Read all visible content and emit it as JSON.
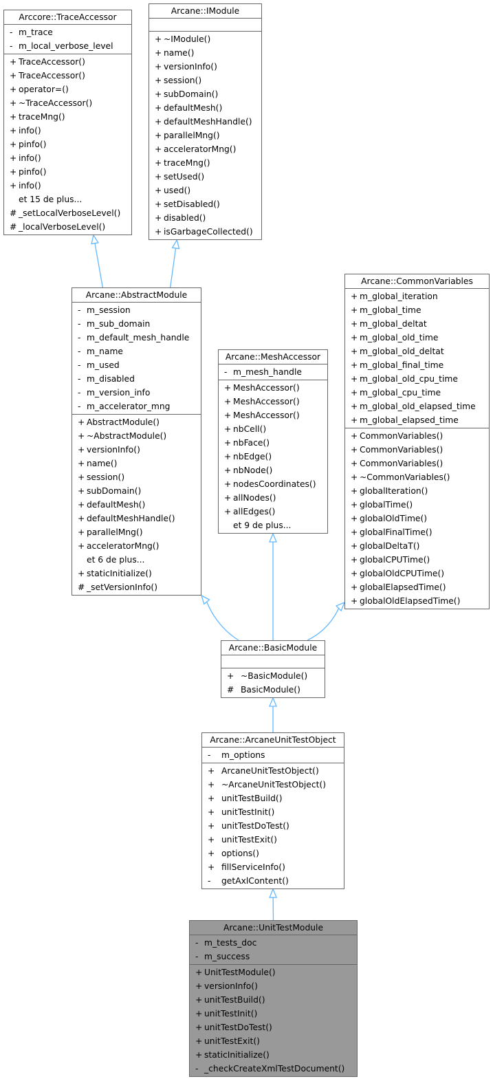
{
  "diagram": {
    "edge_color": "#63b8ff",
    "highlight_color": "#999999",
    "classes": {
      "trace_accessor": {
        "name": "Arccore::TraceAccessor",
        "attributes": [
          {
            "vis": "-",
            "name": "m_trace"
          },
          {
            "vis": "-",
            "name": "m_local_verbose_level"
          }
        ],
        "methods": [
          {
            "vis": "+",
            "name": "TraceAccessor()"
          },
          {
            "vis": "+",
            "name": "TraceAccessor()"
          },
          {
            "vis": "+",
            "name": "operator=()"
          },
          {
            "vis": "+",
            "name": "~TraceAccessor()"
          },
          {
            "vis": "+",
            "name": "traceMng()"
          },
          {
            "vis": "+",
            "name": "info()"
          },
          {
            "vis": "+",
            "name": "pinfo()"
          },
          {
            "vis": "+",
            "name": "info()"
          },
          {
            "vis": "+",
            "name": "pinfo()"
          },
          {
            "vis": "+",
            "name": "info()"
          },
          {
            "vis": "",
            "name": "et 15 de plus..."
          },
          {
            "vis": "#",
            "name": "_setLocalVerboseLevel()"
          },
          {
            "vis": "#",
            "name": "_localVerboseLevel()"
          }
        ]
      },
      "imodule": {
        "name": "Arcane::IModule",
        "attributes": [],
        "methods": [
          {
            "vis": "+",
            "name": "~IModule()"
          },
          {
            "vis": "+",
            "name": "name()"
          },
          {
            "vis": "+",
            "name": "versionInfo()"
          },
          {
            "vis": "+",
            "name": "session()"
          },
          {
            "vis": "+",
            "name": "subDomain()"
          },
          {
            "vis": "+",
            "name": "defaultMesh()"
          },
          {
            "vis": "+",
            "name": "defaultMeshHandle()"
          },
          {
            "vis": "+",
            "name": "parallelMng()"
          },
          {
            "vis": "+",
            "name": "acceleratorMng()"
          },
          {
            "vis": "+",
            "name": "traceMng()"
          },
          {
            "vis": "+",
            "name": "setUsed()"
          },
          {
            "vis": "+",
            "name": "used()"
          },
          {
            "vis": "+",
            "name": "setDisabled()"
          },
          {
            "vis": "+",
            "name": "disabled()"
          },
          {
            "vis": "+",
            "name": "isGarbageCollected()"
          }
        ]
      },
      "abstract_module": {
        "name": "Arcane::AbstractModule",
        "attributes": [
          {
            "vis": "-",
            "name": "m_session"
          },
          {
            "vis": "-",
            "name": "m_sub_domain"
          },
          {
            "vis": "-",
            "name": "m_default_mesh_handle"
          },
          {
            "vis": "-",
            "name": "m_name"
          },
          {
            "vis": "-",
            "name": "m_used"
          },
          {
            "vis": "-",
            "name": "m_disabled"
          },
          {
            "vis": "-",
            "name": "m_version_info"
          },
          {
            "vis": "-",
            "name": "m_accelerator_mng"
          }
        ],
        "methods": [
          {
            "vis": "+",
            "name": "AbstractModule()"
          },
          {
            "vis": "+",
            "name": "~AbstractModule()"
          },
          {
            "vis": "+",
            "name": "versionInfo()"
          },
          {
            "vis": "+",
            "name": "name()"
          },
          {
            "vis": "+",
            "name": "session()"
          },
          {
            "vis": "+",
            "name": "subDomain()"
          },
          {
            "vis": "+",
            "name": "defaultMesh()"
          },
          {
            "vis": "+",
            "name": "defaultMeshHandle()"
          },
          {
            "vis": "+",
            "name": "parallelMng()"
          },
          {
            "vis": "+",
            "name": "acceleratorMng()"
          },
          {
            "vis": "",
            "name": "et 6 de plus..."
          },
          {
            "vis": "+",
            "name": "staticInitialize()"
          },
          {
            "vis": "#",
            "name": "_setVersionInfo()"
          }
        ]
      },
      "mesh_accessor": {
        "name": "Arcane::MeshAccessor",
        "attributes": [
          {
            "vis": "-",
            "name": "m_mesh_handle"
          }
        ],
        "methods": [
          {
            "vis": "+",
            "name": "MeshAccessor()"
          },
          {
            "vis": "+",
            "name": "MeshAccessor()"
          },
          {
            "vis": "+",
            "name": "MeshAccessor()"
          },
          {
            "vis": "+",
            "name": "nbCell()"
          },
          {
            "vis": "+",
            "name": "nbFace()"
          },
          {
            "vis": "+",
            "name": "nbEdge()"
          },
          {
            "vis": "+",
            "name": "nbNode()"
          },
          {
            "vis": "+",
            "name": "nodesCoordinates()"
          },
          {
            "vis": "+",
            "name": "allNodes()"
          },
          {
            "vis": "+",
            "name": "allEdges()"
          },
          {
            "vis": "",
            "name": "et 9 de plus..."
          }
        ]
      },
      "common_variables": {
        "name": "Arcane::CommonVariables",
        "attributes": [
          {
            "vis": "+",
            "name": "m_global_iteration"
          },
          {
            "vis": "+",
            "name": "m_global_time"
          },
          {
            "vis": "+",
            "name": "m_global_deltat"
          },
          {
            "vis": "+",
            "name": "m_global_old_time"
          },
          {
            "vis": "+",
            "name": "m_global_old_deltat"
          },
          {
            "vis": "+",
            "name": "m_global_final_time"
          },
          {
            "vis": "+",
            "name": "m_global_old_cpu_time"
          },
          {
            "vis": "+",
            "name": "m_global_cpu_time"
          },
          {
            "vis": "+",
            "name": "m_global_old_elapsed_time"
          },
          {
            "vis": "+",
            "name": "m_global_elapsed_time"
          }
        ],
        "methods": [
          {
            "vis": "+",
            "name": "CommonVariables()"
          },
          {
            "vis": "+",
            "name": "CommonVariables()"
          },
          {
            "vis": "+",
            "name": "CommonVariables()"
          },
          {
            "vis": "+",
            "name": "~CommonVariables()"
          },
          {
            "vis": "+",
            "name": "globalIteration()"
          },
          {
            "vis": "+",
            "name": "globalTime()"
          },
          {
            "vis": "+",
            "name": "globalOldTime()"
          },
          {
            "vis": "+",
            "name": "globalFinalTime()"
          },
          {
            "vis": "+",
            "name": "globalDeltaT()"
          },
          {
            "vis": "+",
            "name": "globalCPUTime()"
          },
          {
            "vis": "+",
            "name": "globalOldCPUTime()"
          },
          {
            "vis": "+",
            "name": "globalElapsedTime()"
          },
          {
            "vis": "+",
            "name": "globalOldElapsedTime()"
          }
        ]
      },
      "basic_module": {
        "name": "Arcane::BasicModule",
        "attributes": [],
        "methods": [
          {
            "vis": "+",
            "name": "~BasicModule()"
          },
          {
            "vis": "#",
            "name": "BasicModule()"
          }
        ]
      },
      "arcane_unit_test_object": {
        "name": "Arcane::ArcaneUnitTestObject",
        "attributes": [
          {
            "vis": "-",
            "name": "m_options"
          }
        ],
        "methods": [
          {
            "vis": "+",
            "name": "ArcaneUnitTestObject()"
          },
          {
            "vis": "+",
            "name": "~ArcaneUnitTestObject()"
          },
          {
            "vis": "+",
            "name": "unitTestBuild()"
          },
          {
            "vis": "+",
            "name": "unitTestInit()"
          },
          {
            "vis": "+",
            "name": "unitTestDoTest()"
          },
          {
            "vis": "+",
            "name": "unitTestExit()"
          },
          {
            "vis": "+",
            "name": "options()"
          },
          {
            "vis": "+",
            "name": "fillServiceInfo()"
          },
          {
            "vis": "-",
            "name": "getAxlContent()"
          }
        ]
      },
      "unit_test_module": {
        "name": "Arcane::UnitTestModule",
        "highlighted": true,
        "attributes": [
          {
            "vis": "-",
            "name": "m_tests_doc"
          },
          {
            "vis": "-",
            "name": "m_success"
          }
        ],
        "methods": [
          {
            "vis": "+",
            "name": "UnitTestModule()"
          },
          {
            "vis": "+",
            "name": "versionInfo()"
          },
          {
            "vis": "+",
            "name": "unitTestBuild()"
          },
          {
            "vis": "+",
            "name": "unitTestInit()"
          },
          {
            "vis": "+",
            "name": "unitTestDoTest()"
          },
          {
            "vis": "+",
            "name": "unitTestExit()"
          },
          {
            "vis": "+",
            "name": "staticInitialize()"
          },
          {
            "vis": "-",
            "name": "_checkCreateXmlTestDocument()"
          }
        ]
      }
    },
    "inheritance": [
      {
        "child": "abstract_module",
        "parent": "trace_accessor"
      },
      {
        "child": "abstract_module",
        "parent": "imodule"
      },
      {
        "child": "basic_module",
        "parent": "abstract_module"
      },
      {
        "child": "basic_module",
        "parent": "mesh_accessor"
      },
      {
        "child": "basic_module",
        "parent": "common_variables"
      },
      {
        "child": "arcane_unit_test_object",
        "parent": "basic_module"
      },
      {
        "child": "unit_test_module",
        "parent": "arcane_unit_test_object"
      }
    ]
  }
}
